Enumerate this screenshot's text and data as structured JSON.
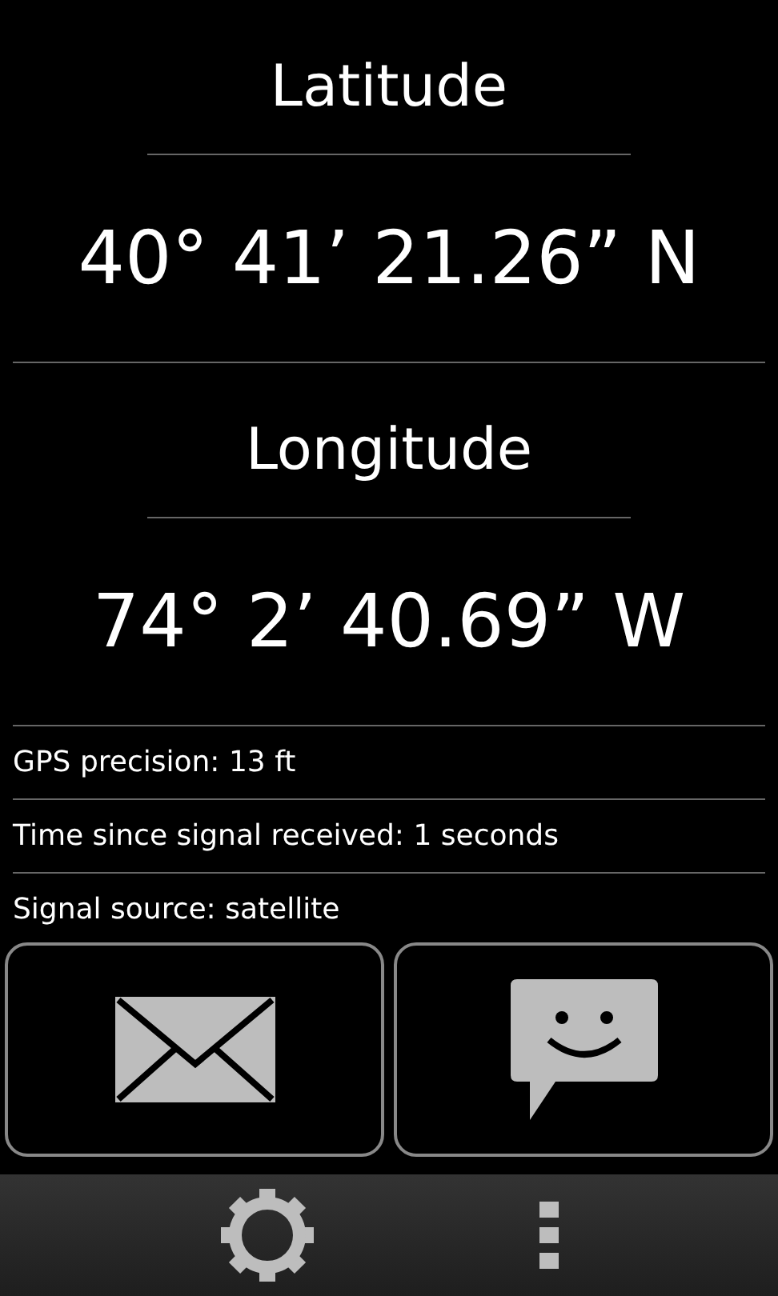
{
  "coordinates": [
    {
      "label": "Latitude",
      "value": "40° 41’ 21.26” N"
    },
    {
      "label": "Longitude",
      "value": "74° 2’ 40.69” W"
    }
  ],
  "info_rows": [
    "GPS precision: 13 ft",
    "Time since signal received: 1 seconds",
    "Signal source: satellite"
  ],
  "share_buttons": [
    {
      "kind": "email"
    },
    {
      "kind": "message"
    }
  ],
  "app_bar": [
    {
      "kind": "settings"
    },
    {
      "kind": "more"
    }
  ]
}
